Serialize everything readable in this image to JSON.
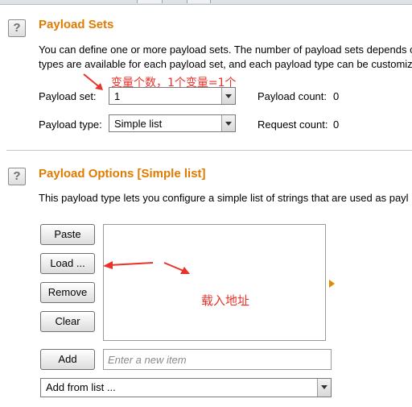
{
  "payload_sets": {
    "title": "Payload Sets",
    "description_line1": "You can define one or more payload sets. The number of payload sets depends o",
    "description_line2": "types are available for each payload set, and each payload type can be customiz",
    "payload_set_label": "Payload set:",
    "payload_set_value": "1",
    "payload_count_label": "Payload count:",
    "payload_count_value": "0",
    "payload_type_label": "Payload type:",
    "payload_type_value": "Simple list",
    "request_count_label": "Request count:",
    "request_count_value": "0"
  },
  "payload_options": {
    "title": "Payload Options [Simple list]",
    "description": "This payload type lets you configure a simple list of strings that are used as payl",
    "buttons": {
      "paste": "Paste",
      "load": "Load ...",
      "remove": "Remove",
      "clear": "Clear",
      "add": "Add"
    },
    "new_item_placeholder": "Enter a new item",
    "add_from_list": "Add from list ..."
  },
  "annotations": {
    "variable_count": "变量个数，1个变量=1个",
    "load_address": "载入地址"
  },
  "help_glyph": "?",
  "colors": {
    "section_title": "#e07b00",
    "annotation": "#e8322a"
  }
}
